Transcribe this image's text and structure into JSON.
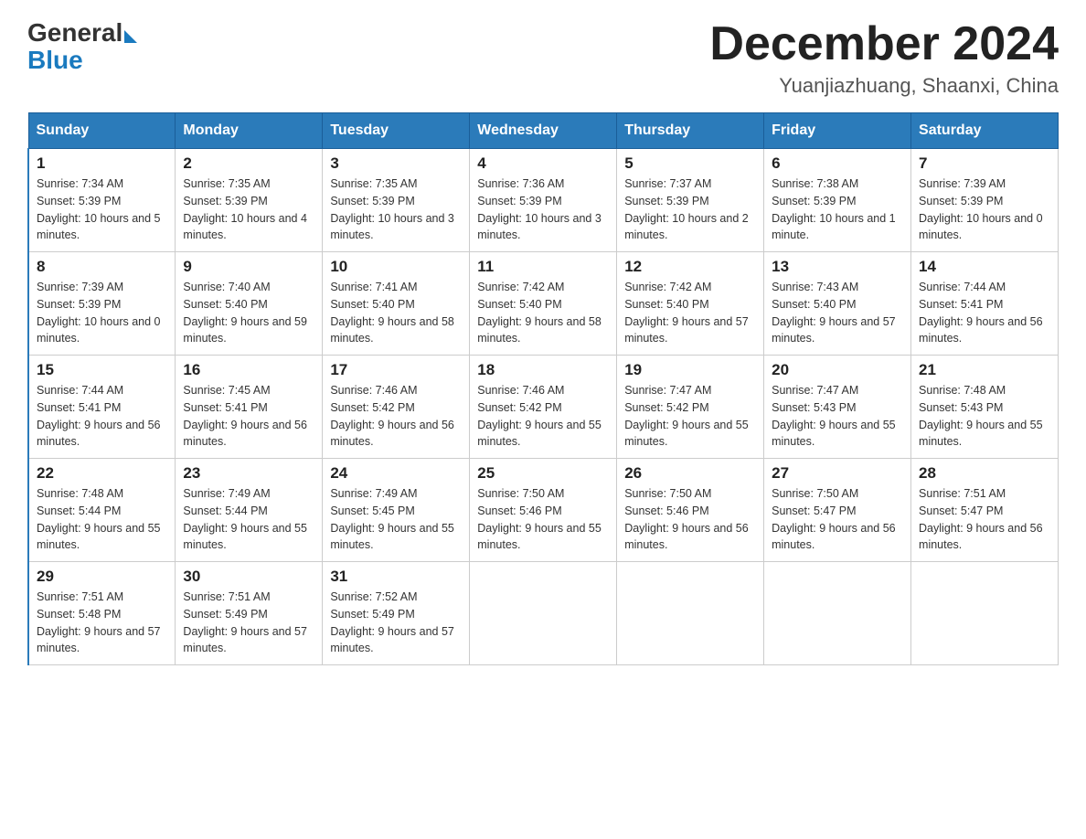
{
  "header": {
    "logo_general": "General",
    "logo_blue": "Blue",
    "month_title": "December 2024",
    "location": "Yuanjiazhuang, Shaanxi, China"
  },
  "days_of_week": [
    "Sunday",
    "Monday",
    "Tuesday",
    "Wednesday",
    "Thursday",
    "Friday",
    "Saturday"
  ],
  "weeks": [
    [
      {
        "day": "1",
        "sunrise": "7:34 AM",
        "sunset": "5:39 PM",
        "daylight": "10 hours and 5 minutes."
      },
      {
        "day": "2",
        "sunrise": "7:35 AM",
        "sunset": "5:39 PM",
        "daylight": "10 hours and 4 minutes."
      },
      {
        "day": "3",
        "sunrise": "7:35 AM",
        "sunset": "5:39 PM",
        "daylight": "10 hours and 3 minutes."
      },
      {
        "day": "4",
        "sunrise": "7:36 AM",
        "sunset": "5:39 PM",
        "daylight": "10 hours and 3 minutes."
      },
      {
        "day": "5",
        "sunrise": "7:37 AM",
        "sunset": "5:39 PM",
        "daylight": "10 hours and 2 minutes."
      },
      {
        "day": "6",
        "sunrise": "7:38 AM",
        "sunset": "5:39 PM",
        "daylight": "10 hours and 1 minute."
      },
      {
        "day": "7",
        "sunrise": "7:39 AM",
        "sunset": "5:39 PM",
        "daylight": "10 hours and 0 minutes."
      }
    ],
    [
      {
        "day": "8",
        "sunrise": "7:39 AM",
        "sunset": "5:39 PM",
        "daylight": "10 hours and 0 minutes."
      },
      {
        "day": "9",
        "sunrise": "7:40 AM",
        "sunset": "5:40 PM",
        "daylight": "9 hours and 59 minutes."
      },
      {
        "day": "10",
        "sunrise": "7:41 AM",
        "sunset": "5:40 PM",
        "daylight": "9 hours and 58 minutes."
      },
      {
        "day": "11",
        "sunrise": "7:42 AM",
        "sunset": "5:40 PM",
        "daylight": "9 hours and 58 minutes."
      },
      {
        "day": "12",
        "sunrise": "7:42 AM",
        "sunset": "5:40 PM",
        "daylight": "9 hours and 57 minutes."
      },
      {
        "day": "13",
        "sunrise": "7:43 AM",
        "sunset": "5:40 PM",
        "daylight": "9 hours and 57 minutes."
      },
      {
        "day": "14",
        "sunrise": "7:44 AM",
        "sunset": "5:41 PM",
        "daylight": "9 hours and 56 minutes."
      }
    ],
    [
      {
        "day": "15",
        "sunrise": "7:44 AM",
        "sunset": "5:41 PM",
        "daylight": "9 hours and 56 minutes."
      },
      {
        "day": "16",
        "sunrise": "7:45 AM",
        "sunset": "5:41 PM",
        "daylight": "9 hours and 56 minutes."
      },
      {
        "day": "17",
        "sunrise": "7:46 AM",
        "sunset": "5:42 PM",
        "daylight": "9 hours and 56 minutes."
      },
      {
        "day": "18",
        "sunrise": "7:46 AM",
        "sunset": "5:42 PM",
        "daylight": "9 hours and 55 minutes."
      },
      {
        "day": "19",
        "sunrise": "7:47 AM",
        "sunset": "5:42 PM",
        "daylight": "9 hours and 55 minutes."
      },
      {
        "day": "20",
        "sunrise": "7:47 AM",
        "sunset": "5:43 PM",
        "daylight": "9 hours and 55 minutes."
      },
      {
        "day": "21",
        "sunrise": "7:48 AM",
        "sunset": "5:43 PM",
        "daylight": "9 hours and 55 minutes."
      }
    ],
    [
      {
        "day": "22",
        "sunrise": "7:48 AM",
        "sunset": "5:44 PM",
        "daylight": "9 hours and 55 minutes."
      },
      {
        "day": "23",
        "sunrise": "7:49 AM",
        "sunset": "5:44 PM",
        "daylight": "9 hours and 55 minutes."
      },
      {
        "day": "24",
        "sunrise": "7:49 AM",
        "sunset": "5:45 PM",
        "daylight": "9 hours and 55 minutes."
      },
      {
        "day": "25",
        "sunrise": "7:50 AM",
        "sunset": "5:46 PM",
        "daylight": "9 hours and 55 minutes."
      },
      {
        "day": "26",
        "sunrise": "7:50 AM",
        "sunset": "5:46 PM",
        "daylight": "9 hours and 56 minutes."
      },
      {
        "day": "27",
        "sunrise": "7:50 AM",
        "sunset": "5:47 PM",
        "daylight": "9 hours and 56 minutes."
      },
      {
        "day": "28",
        "sunrise": "7:51 AM",
        "sunset": "5:47 PM",
        "daylight": "9 hours and 56 minutes."
      }
    ],
    [
      {
        "day": "29",
        "sunrise": "7:51 AM",
        "sunset": "5:48 PM",
        "daylight": "9 hours and 57 minutes."
      },
      {
        "day": "30",
        "sunrise": "7:51 AM",
        "sunset": "5:49 PM",
        "daylight": "9 hours and 57 minutes."
      },
      {
        "day": "31",
        "sunrise": "7:52 AM",
        "sunset": "5:49 PM",
        "daylight": "9 hours and 57 minutes."
      },
      null,
      null,
      null,
      null
    ]
  ]
}
